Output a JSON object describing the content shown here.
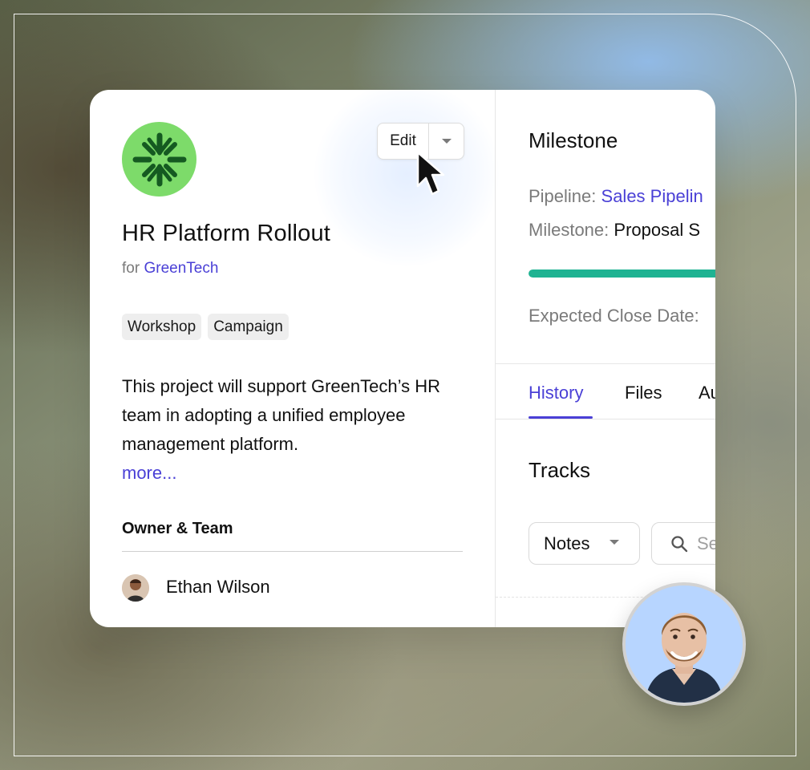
{
  "project": {
    "title": "HR Platform Rollout",
    "client_prefix": "for",
    "client_name": "GreenTech",
    "tags": [
      "Workshop",
      "Campaign"
    ],
    "description": "This project will support GreenTech’s HR team in adopting a unified employee management platform.",
    "more_link": "more...",
    "logo_icon": "green-asterisk-logo-icon"
  },
  "toolbar": {
    "edit_label": "Edit",
    "dropdown_icon": "chevron-down-icon"
  },
  "owner_team": {
    "heading": "Owner & Team",
    "owner": {
      "name": "Ethan Wilson",
      "avatar": "avatar"
    }
  },
  "milestone_panel": {
    "title": "Milestone",
    "pipeline": {
      "label": "Pipeline:",
      "value": "Sales Pipelin"
    },
    "milestone": {
      "label": "Milestone:",
      "value": "Proposal S"
    },
    "progress": {
      "value": 1.0,
      "color": "#1fb392"
    },
    "expected_close": {
      "label": "Expected Close Date:"
    }
  },
  "tabs": [
    {
      "label": "History",
      "active": true
    },
    {
      "label": "Files",
      "active": false
    },
    {
      "label": "Au",
      "active": false
    }
  ],
  "tracks": {
    "title": "Tracks",
    "filter": {
      "label": "Notes",
      "icon": "chevron-down-icon"
    },
    "search": {
      "placeholder": "Se",
      "icon": "search-icon"
    }
  },
  "colors": {
    "accent": "#4a40d6",
    "progress": "#1fb392",
    "logo": "#7ddb6a",
    "avatar_bg": "#b7d5ff"
  },
  "icons": {
    "cursor": "mouse-pointer-icon",
    "profile": "profile-avatar"
  }
}
